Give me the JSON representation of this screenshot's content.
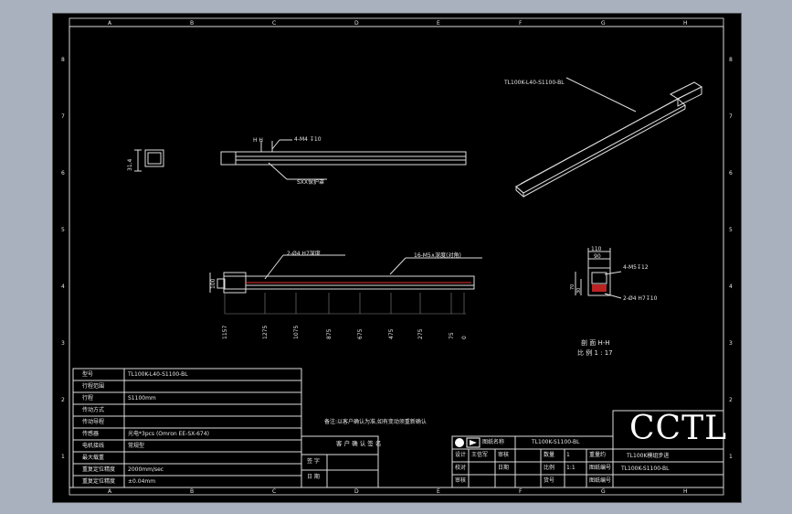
{
  "frame": {
    "top_letters": [
      "A",
      "B",
      "C",
      "D",
      "E",
      "F",
      "G",
      "H"
    ],
    "side_numbers": [
      "8",
      "7",
      "6",
      "5",
      "4",
      "3",
      "2",
      "1"
    ]
  },
  "drawing": {
    "iso_label": "TL100K-L40-S1100-BL",
    "top_view": {
      "callout_hh": "H    H",
      "callout_tap": "4-M4 ↧10",
      "callout_sleeve": "SXX保护罩"
    },
    "end_dim": "31.4",
    "front_view": {
      "callout_pins": "2-Ø4 H7深度",
      "callout_taps": "16-M5∧深度(对角)",
      "left_dim": "100",
      "dims": [
        "1157",
        "1275",
        "1075",
        "875",
        "675",
        "475",
        "275",
        "75",
        "0"
      ]
    },
    "section": {
      "top_dims": [
        "110",
        "90"
      ],
      "callout_tap": "4-M5↧12",
      "callout_pin": "2-Ø4 H7↧10",
      "side_dims": [
        "70",
        "30"
      ],
      "title": "剖 面 H-H",
      "scale": "比 例 1 : 17"
    },
    "note": "备注:以客户确认为准,如有变动须重新确认"
  },
  "spec_table": {
    "rows": [
      {
        "label": "型号",
        "value": "TL100K-L40-S1100-BL"
      },
      {
        "label": "行程范围",
        "value": ""
      },
      {
        "label": "行程",
        "value": "S1100mm"
      },
      {
        "label": "传动方式",
        "value": ""
      },
      {
        "label": "传动导程",
        "value": ""
      },
      {
        "label": "传感器",
        "value": "光电*3pcs (Omron EE-SX-674)"
      },
      {
        "label": "电机接线",
        "value": "常规型"
      },
      {
        "label": "最大载重",
        "value": ""
      },
      {
        "label": "重复定位精度",
        "value": "2000mm/sec"
      },
      {
        "label": "重复定位精度",
        "value": "±0.04mm"
      }
    ]
  },
  "confirm_box": {
    "title": "客 户 确 认 签 名",
    "sign_label": "签 字",
    "date_label": "日 期"
  },
  "title_block": {
    "part_label": "图纸名称",
    "part_number": "TL100K-S1100-BL",
    "brand": "CCTL",
    "product_name": "TL100K模组步进",
    "drawing_no": "TL100K-S1100-BL",
    "rows": [
      [
        "设计",
        "王信军",
        "审核",
        "",
        "数量",
        "1",
        "重量约",
        ""
      ],
      [
        "校对",
        "",
        "日期",
        "",
        "比例",
        "1:1",
        "图纸编号",
        ""
      ],
      [
        "审核",
        "",
        "",
        "",
        "货号",
        "",
        "图纸编号",
        ""
      ]
    ]
  }
}
